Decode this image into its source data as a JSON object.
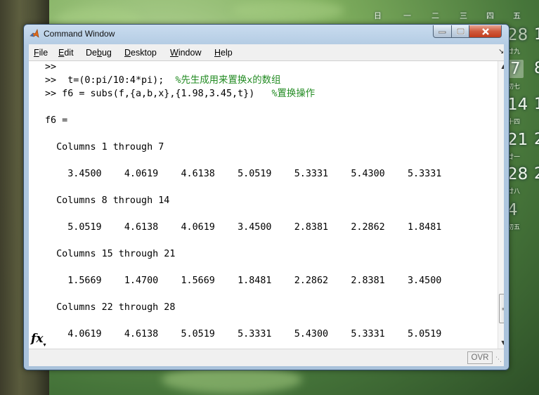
{
  "window": {
    "title": "Command Window"
  },
  "menu": [
    {
      "label": "File",
      "mnemonic": "F",
      "rest": "ile"
    },
    {
      "label": "Edit",
      "mnemonic": "E",
      "rest": "dit"
    },
    {
      "pre": "De",
      "label": "Debug",
      "mnemonic": "b",
      "rest": "ug"
    },
    {
      "label": "Desktop",
      "mnemonic": "D",
      "rest": "esktop"
    },
    {
      "label": "Window",
      "mnemonic": "W",
      "rest": "indow"
    },
    {
      "label": "Help",
      "mnemonic": "H",
      "rest": "elp"
    }
  ],
  "console": {
    "lines": [
      {
        "text": ">>"
      },
      {
        "text": ">>  t=(0:pi/10:4*pi);  ",
        "comment": "%先生成用来置换x的数组"
      },
      {
        "text": ">> f6 = subs(f,{a,b,x},{1.98,3.45,t})   ",
        "comment": "%置换操作"
      },
      {
        "text": ""
      },
      {
        "text": "f6 ="
      },
      {
        "text": ""
      },
      {
        "text": "  Columns 1 through 7"
      },
      {
        "text": ""
      },
      {
        "text": "    3.4500    4.0619    4.6138    5.0519    5.3331    5.4300    5.3331"
      },
      {
        "text": ""
      },
      {
        "text": "  Columns 8 through 14"
      },
      {
        "text": ""
      },
      {
        "text": "    5.0519    4.6138    4.0619    3.4500    2.8381    2.2862    1.8481"
      },
      {
        "text": ""
      },
      {
        "text": "  Columns 15 through 21"
      },
      {
        "text": ""
      },
      {
        "text": "    1.5669    1.4700    1.5669    1.8481    2.2862    2.8381    3.4500"
      },
      {
        "text": ""
      },
      {
        "text": "  Columns 22 through 28"
      },
      {
        "text": ""
      },
      {
        "text": "    4.0619    4.6138    5.0519    5.3331    5.4300    5.3331    5.0519"
      }
    ],
    "prompt_icon": "fx",
    "prompt_caret": "▾"
  },
  "status": {
    "ovr": "OVR"
  },
  "calendar": {
    "weekdays": [
      "日",
      "一",
      "二",
      "三",
      "四",
      "五"
    ],
    "days": [
      {
        "num": "28",
        "sub": "廿九",
        "dim": true
      },
      {
        "num": "7",
        "sub": "初七",
        "selected": true
      },
      {
        "num": "14",
        "sub": "十四"
      },
      {
        "num": "21",
        "sub": "廿一"
      },
      {
        "num": "28",
        "sub": "廿八"
      },
      {
        "num": "4",
        "sub": "初五",
        "dim": true
      }
    ],
    "tail": [
      "1",
      "8",
      "1",
      "2",
      "2",
      ""
    ]
  },
  "colors": {
    "comment": "#228b22",
    "title_bar": "#b3cbe3",
    "close_button": "#c23c1d"
  }
}
